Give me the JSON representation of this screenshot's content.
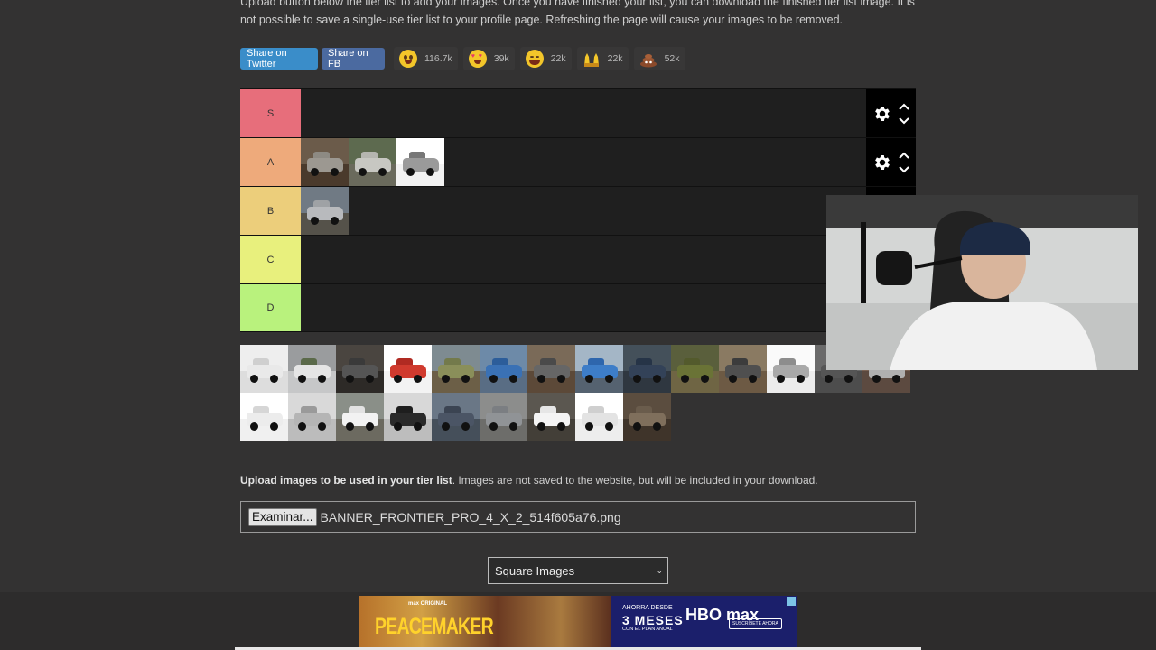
{
  "intro_text": "Upload button below the tier list to add your images. Once you have finished your list, you can download the finished tier list image. It is not possible to save a single-use tier list to your profile page. Refreshing the page will cause your images to be removed.",
  "share": {
    "twitter_label": "Share on Twitter",
    "fb_label": "Share on FB"
  },
  "reactions": [
    {
      "icon": "grinning-face-icon",
      "count": "116.7k"
    },
    {
      "icon": "heart-eyes-icon",
      "count": "39k"
    },
    {
      "icon": "laughing-face-icon",
      "count": "22k"
    },
    {
      "icon": "raised-hands-icon",
      "count": "22k"
    },
    {
      "icon": "poop-icon",
      "count": "52k"
    }
  ],
  "tiers": [
    {
      "label": "S",
      "color": "#e76e7b"
    },
    {
      "label": "A",
      "color": "#eeaa7b"
    },
    {
      "label": "B",
      "color": "#ecce7b"
    },
    {
      "label": "C",
      "color": "#e8f07d"
    },
    {
      "label": "D",
      "color": "#b9f27d"
    }
  ],
  "upload": {
    "bold_text": "Upload images to be used in your tier list",
    "rest_text": ". Images are not saved to the website, but will be included in your download.",
    "browse_label": "Examinar...",
    "file_name": "BANNER_FRONTIER_PRO_4_X_2_514f605a76.png"
  },
  "image_style_select": {
    "value": "Square Images"
  },
  "ad": {
    "max_original": "max ORIGINAL",
    "title": "PEACEMAKER",
    "ahorra": "AHORRA DESDE",
    "meses": "3 MESES",
    "plan": "CON EL PLAN ANUAL",
    "brand": "HBO max",
    "cta": "SUSCRÍBETE AHORA"
  },
  "colors": {
    "background": "#333232",
    "tier_items_bg": "#1f1f1f",
    "twitter": "#3a8dc9",
    "facebook": "#4b6aa0"
  }
}
